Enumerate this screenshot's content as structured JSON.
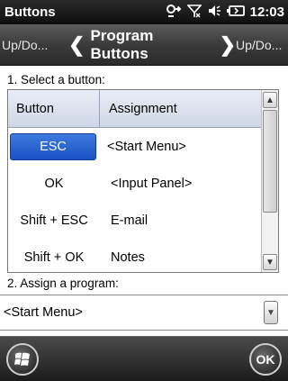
{
  "titlebar": {
    "title": "Buttons",
    "clock": "12:03",
    "icons": [
      "sync-icon",
      "signal-off-icon",
      "speaker-icon",
      "battery-icon"
    ]
  },
  "nav": {
    "left_label": "Up/Do...",
    "title": "Program Buttons",
    "right_label": "Up/Do..."
  },
  "step1_label": "1. Select a button:",
  "list": {
    "headers": [
      "Button",
      "Assignment"
    ],
    "rows": [
      {
        "button": "ESC",
        "assignment": "<Start Menu>",
        "selected": true
      },
      {
        "button": "OK",
        "assignment": "<Input Panel>",
        "selected": false
      },
      {
        "button": "Shift + ESC",
        "assignment": "E-mail",
        "selected": false
      },
      {
        "button": "Shift + OK",
        "assignment": "Notes",
        "selected": false
      }
    ]
  },
  "step2_label": "2. Assign a program:",
  "program_select": {
    "value": "<Start Menu>"
  },
  "bottom": {
    "ok_label": "OK"
  },
  "colors": {
    "selection": "#2a62d2",
    "bar": "#1c1c1c"
  }
}
